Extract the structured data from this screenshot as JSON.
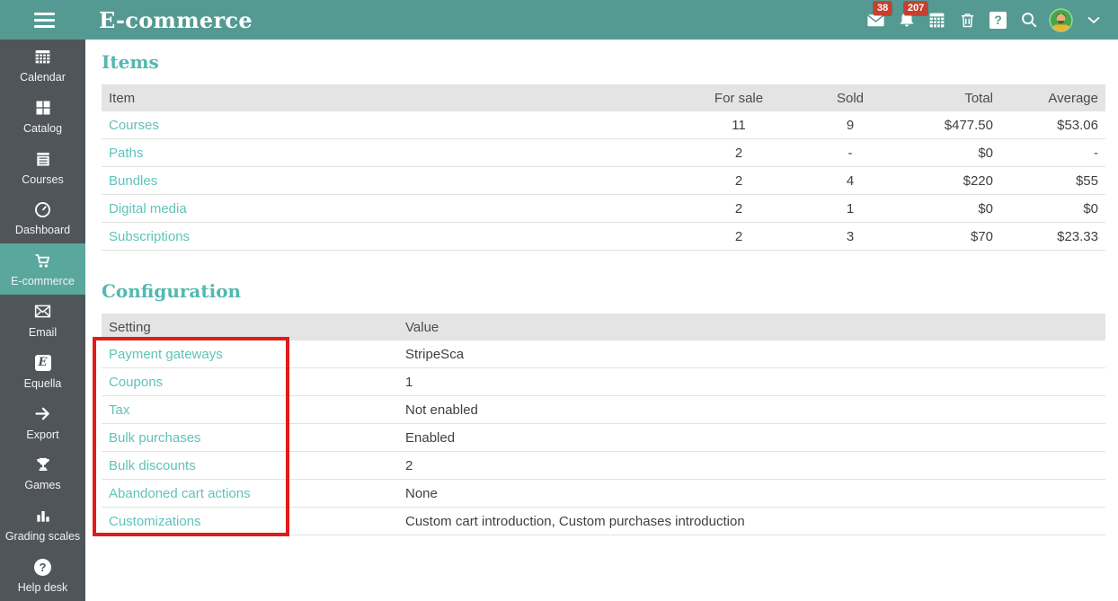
{
  "colors": {
    "topbar": "#549a93",
    "sidebar": "#50555a",
    "sidebar-active": "#5aa79e",
    "accent": "#52b9af",
    "link": "#5fc3ba",
    "badge": "#c5402f",
    "table-header-bg": "#e4e4e4",
    "table-header-text": "#4b4b4b",
    "row-text": "#3f3f3f",
    "row-border": "#e2e2e2",
    "annotation": "#e21b1b",
    "avatar-green": "#46a64b",
    "avatar-shirt": "#f2b32a"
  },
  "header": {
    "title": "E-commerce",
    "messages_badge": "38",
    "notifications_badge": "207",
    "help_glyph": "?"
  },
  "sidebar": {
    "items": [
      {
        "label": "Calendar",
        "active": false
      },
      {
        "label": "Catalog",
        "active": false
      },
      {
        "label": "Courses",
        "active": false
      },
      {
        "label": "Dashboard",
        "active": false
      },
      {
        "label": "E-commerce",
        "active": true
      },
      {
        "label": "Email",
        "active": false
      },
      {
        "label": "Equella",
        "active": false,
        "glyph": "E"
      },
      {
        "label": "Export",
        "active": false
      },
      {
        "label": "Games",
        "active": false
      },
      {
        "label": "Grading scales",
        "active": false
      },
      {
        "label": "Help desk",
        "active": false,
        "glyph": "?"
      }
    ]
  },
  "items_section": {
    "title": "Items",
    "columns": [
      "Item",
      "For sale",
      "Sold",
      "Total",
      "Average"
    ],
    "rows": [
      [
        "Courses",
        "11",
        "9",
        "$477.50",
        "$53.06"
      ],
      [
        "Paths",
        "2",
        "-",
        "$0",
        "-"
      ],
      [
        "Bundles",
        "2",
        "4",
        "$220",
        "$55"
      ],
      [
        "Digital media",
        "2",
        "1",
        "$0",
        "$0"
      ],
      [
        "Subscriptions",
        "2",
        "3",
        "$70",
        "$23.33"
      ]
    ]
  },
  "config_section": {
    "title": "Configuration",
    "columns": [
      "Setting",
      "Value"
    ],
    "rows": [
      [
        "Payment gateways",
        "StripeSca"
      ],
      [
        "Coupons",
        "1"
      ],
      [
        "Tax",
        "Not enabled"
      ],
      [
        "Bulk purchases",
        "Enabled"
      ],
      [
        "Bulk discounts",
        "2"
      ],
      [
        "Abandoned cart actions",
        "None"
      ],
      [
        "Customizations",
        "Custom cart introduction, Custom purchases introduction"
      ]
    ]
  }
}
